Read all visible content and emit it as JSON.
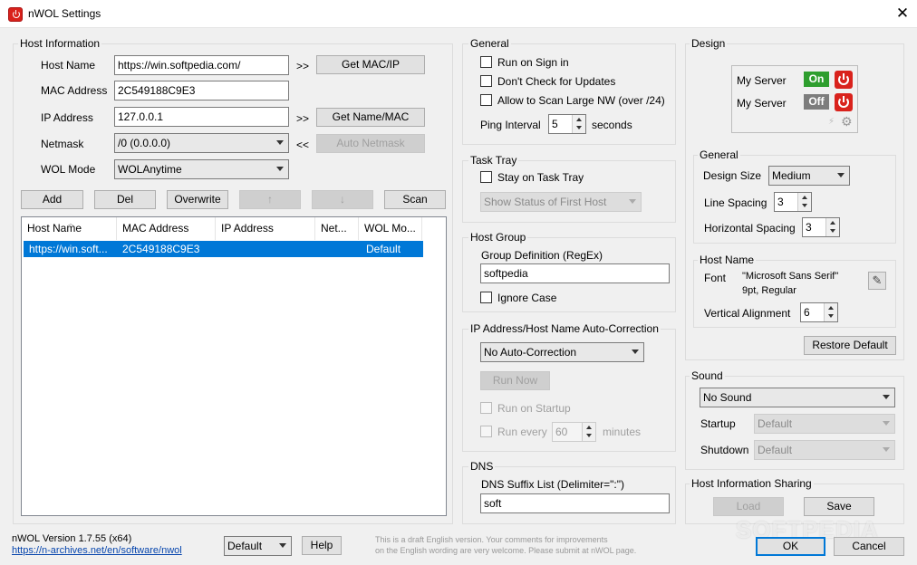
{
  "window": {
    "title": "nWOL Settings"
  },
  "host_info": {
    "group_label": "Host Information",
    "host_name_label": "Host Name",
    "host_name_value": "https://win.softpedia.com/",
    "mac_label": "MAC Address",
    "mac_value": "2C549188C9E3",
    "ip_label": "IP Address",
    "ip_value": "127.0.0.1",
    "netmask_label": "Netmask",
    "netmask_value": "/0  (0.0.0.0)",
    "wol_mode_label": "WOL Mode",
    "wol_mode_value": "WOLAnytime",
    "arrow_right1": ">>",
    "arrow_right2": ">>",
    "arrow_left": "<<",
    "get_mac_btn": "Get MAC/IP",
    "get_name_btn": "Get Name/MAC",
    "auto_netmask_btn": "Auto Netmask",
    "add_btn": "Add",
    "del_btn": "Del",
    "overwrite_btn": "Overwrite",
    "up_btn": "↑",
    "down_btn": "↓",
    "scan_btn": "Scan"
  },
  "hosts_table": {
    "columns": [
      "Host Name",
      "MAC Address",
      "IP Address",
      "Net...",
      "WOL Mo..."
    ],
    "rows": [
      {
        "host_name": "https://win.soft...",
        "mac": "2C549188C9E3",
        "ip": "",
        "net": "",
        "wol_mode": "Default"
      }
    ]
  },
  "general": {
    "group_label": "General",
    "run_on_signin": "Run on Sign in",
    "dont_check_updates": "Don't Check for Updates",
    "allow_scan_large": "Allow to Scan Large NW (over /24)",
    "ping_interval_label": "Ping Interval",
    "ping_interval_value": "5",
    "seconds_label": "seconds"
  },
  "task_tray": {
    "group_label": "Task Tray",
    "stay_on_tray": "Stay on Task Tray",
    "show_status_value": "Show Status of First Host"
  },
  "host_group": {
    "group_label": "Host Group",
    "group_def_label": "Group Definition (RegEx)",
    "group_def_value": "softpedia",
    "ignore_case": "Ignore Case"
  },
  "auto_correction": {
    "group_label": "IP Address/Host Name Auto-Correction",
    "mode_value": "No Auto-Correction",
    "run_now_btn": "Run Now",
    "run_on_startup": "Run on Startup",
    "run_every": "Run every",
    "run_every_value": "60",
    "minutes_label": "minutes"
  },
  "dns": {
    "group_label": "DNS",
    "suffix_label": "DNS Suffix List (Delimiter=\":\")",
    "suffix_value": "soft"
  },
  "design": {
    "group_label": "Design",
    "preview": [
      {
        "name": "My Server",
        "status": "On",
        "status_color": "#2e9e2e"
      },
      {
        "name": "My Server",
        "status": "Off",
        "status_color": "#7d7d7d"
      }
    ],
    "general_label": "General",
    "design_size_label": "Design Size",
    "design_size_value": "Medium",
    "line_spacing_label": "Line Spacing",
    "line_spacing_value": "3",
    "h_spacing_label": "Horizontal Spacing",
    "h_spacing_value": "3",
    "host_name_label": "Host Name",
    "font_label": "Font",
    "font_value_line1": "\"Microsoft Sans Serif\"",
    "font_value_line2": "9pt, Regular",
    "vertical_align_label": "Vertical Alignment",
    "vertical_align_value": "6",
    "restore_btn": "Restore Default"
  },
  "sound": {
    "group_label": "Sound",
    "sound_value": "No Sound",
    "startup_label": "Startup",
    "startup_value": "Default",
    "shutdown_label": "Shutdown",
    "shutdown_value": "Default"
  },
  "sharing": {
    "group_label": "Host Information Sharing",
    "load_btn": "Load",
    "save_btn": "Save"
  },
  "footer": {
    "version": "nWOL Version 1.7.55 (x64)",
    "link": "https://n-archives.net/en/software/nwol",
    "language_value": "Default",
    "help_btn": "Help",
    "note_line1": "This is a draft English version. Your comments for improvements",
    "note_line2": "on the English wording are very welcome. Please submit at nWOL page.",
    "ok_btn": "OK",
    "cancel_btn": "Cancel"
  },
  "watermark": "SOFTPEDIA",
  "colors": {
    "accent": "#0078d7",
    "power": "#d9221c"
  }
}
